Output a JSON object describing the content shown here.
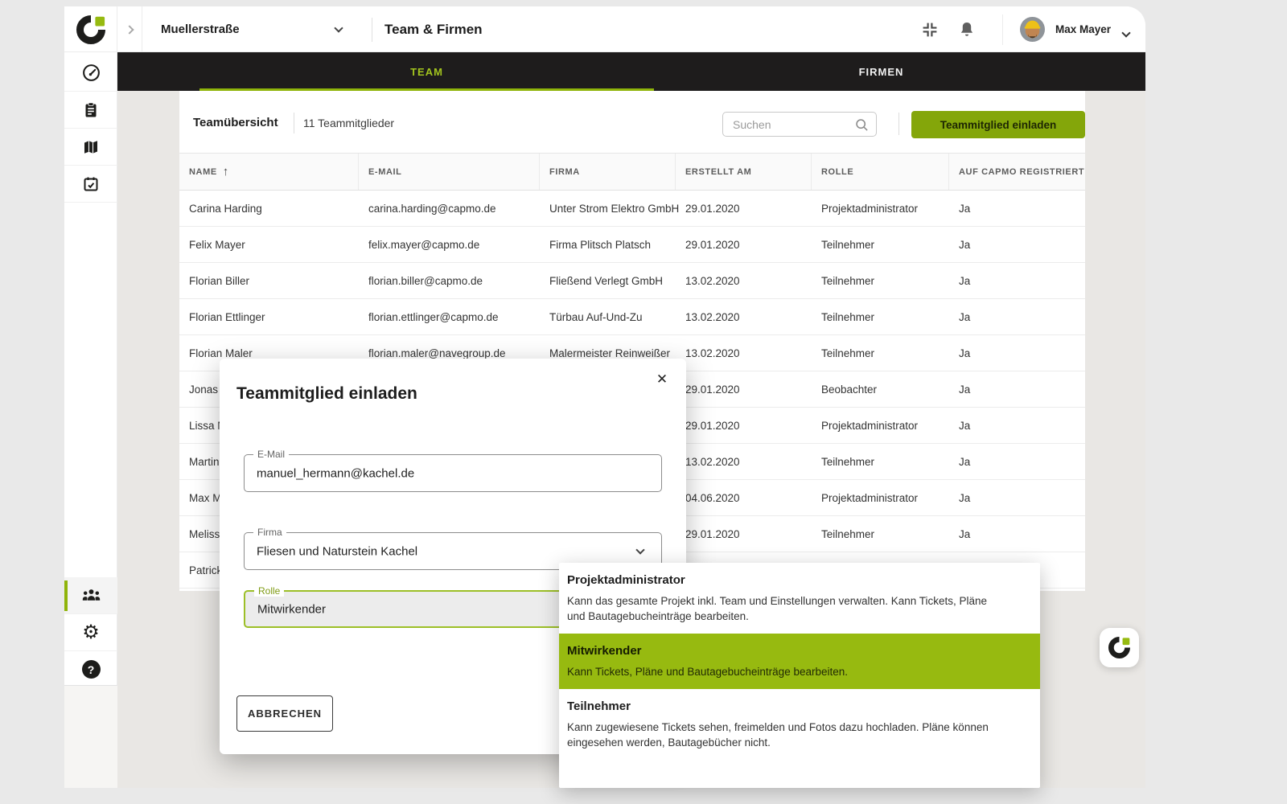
{
  "colors": {
    "brand_green_button": "#84a60a",
    "highlight_green": "#97ba10",
    "tab_green": "#a2c41e",
    "underline_green": "#8fb40a",
    "dark_bar": "#1e1c1c"
  },
  "topbar": {
    "project_name": "Muellerstraße",
    "page_title": "Team & Firmen",
    "user_name": "Max Mayer"
  },
  "tabs": {
    "team": "TEAM",
    "firmen": "FIRMEN"
  },
  "sidebar": {
    "items": [
      "dashboard",
      "tickets",
      "plans",
      "construction-diary",
      "team",
      "settings",
      "help"
    ]
  },
  "icons": {
    "help_glyph": "?",
    "close_glyph": "✕",
    "sort_asc_glyph": "↑"
  },
  "toolbar": {
    "overview_label": "Teamübersicht",
    "member_count": "11 Teammitglieder",
    "search_placeholder": "Suchen",
    "invite_button_label": "Teammitglied einladen"
  },
  "table": {
    "columns": [
      "NAME",
      "E-MAIL",
      "FIRMA",
      "ERSTELLT AM",
      "ROLLE",
      "AUF CAPMO REGISTRIERT"
    ],
    "rows": [
      {
        "name": "Carina Harding",
        "email": "carina.harding@capmo.de",
        "firma": "Unter Strom Elektro GmbH",
        "erstellt": "29.01.2020",
        "rolle": "Projektadministrator",
        "registriert": "Ja"
      },
      {
        "name": "Felix Mayer",
        "email": "felix.mayer@capmo.de",
        "firma": "Firma Plitsch Platsch",
        "erstellt": "29.01.2020",
        "rolle": "Teilnehmer",
        "registriert": "Ja"
      },
      {
        "name": "Florian Biller",
        "email": "florian.biller@capmo.de",
        "firma": "Fließend Verlegt GmbH",
        "erstellt": "13.02.2020",
        "rolle": "Teilnehmer",
        "registriert": "Ja"
      },
      {
        "name": "Florian Ettlinger",
        "email": "florian.ettlinger@capmo.de",
        "firma": "Türbau Auf-Und-Zu",
        "erstellt": "13.02.2020",
        "rolle": "Teilnehmer",
        "registriert": "Ja"
      },
      {
        "name": "Florian Maler",
        "email": "florian.maler@navegroup.de",
        "firma": "Malermeister Reinweißer",
        "erstellt": "13.02.2020",
        "rolle": "Teilnehmer",
        "registriert": "Ja"
      },
      {
        "name": "Jonas",
        "email": "",
        "firma": "",
        "erstellt": "29.01.2020",
        "rolle": "Beobachter",
        "registriert": "Ja"
      },
      {
        "name": "Lissa N",
        "email": "",
        "firma": "",
        "erstellt": "29.01.2020",
        "rolle": "Projektadministrator",
        "registriert": "Ja"
      },
      {
        "name": "Martin",
        "email": "",
        "firma": "",
        "erstellt": "13.02.2020",
        "rolle": "Teilnehmer",
        "registriert": "Ja"
      },
      {
        "name": "Max M",
        "email": "",
        "firma": "",
        "erstellt": "04.06.2020",
        "rolle": "Projektadministrator",
        "registriert": "Ja"
      },
      {
        "name": "Meliss",
        "email": "",
        "firma": "",
        "erstellt": "29.01.2020",
        "rolle": "Teilnehmer",
        "registriert": "Ja"
      },
      {
        "name": "Patrick",
        "email": "",
        "firma": "",
        "erstellt": "",
        "rolle": "",
        "registriert": ""
      }
    ]
  },
  "modal": {
    "title": "Teammitglied einladen",
    "email_label": "E-Mail",
    "email_value": "manuel_hermann@kachel.de",
    "firma_label": "Firma",
    "firma_value": "Fliesen und Naturstein Kachel",
    "rolle_label": "Rolle",
    "rolle_value": "Mitwirkender",
    "cancel_button_label": "ABBRECHEN"
  },
  "role_dropdown": {
    "options": [
      {
        "title": "Projektadministrator",
        "description": "Kann das gesamte Projekt inkl. Team und Einstellungen verwalten. Kann Tickets, Pläne und Bautagebucheinträge bearbeiten.",
        "selected": false
      },
      {
        "title": "Mitwirkender",
        "description": "Kann Tickets, Pläne und Bautagebucheinträge bearbeiten.",
        "selected": true
      },
      {
        "title": "Teilnehmer",
        "description": "Kann zugewiesene Tickets sehen, freimelden und Fotos dazu hochladen. Pläne können eingesehen werden, Bautagebücher nicht.",
        "selected": false
      }
    ]
  }
}
